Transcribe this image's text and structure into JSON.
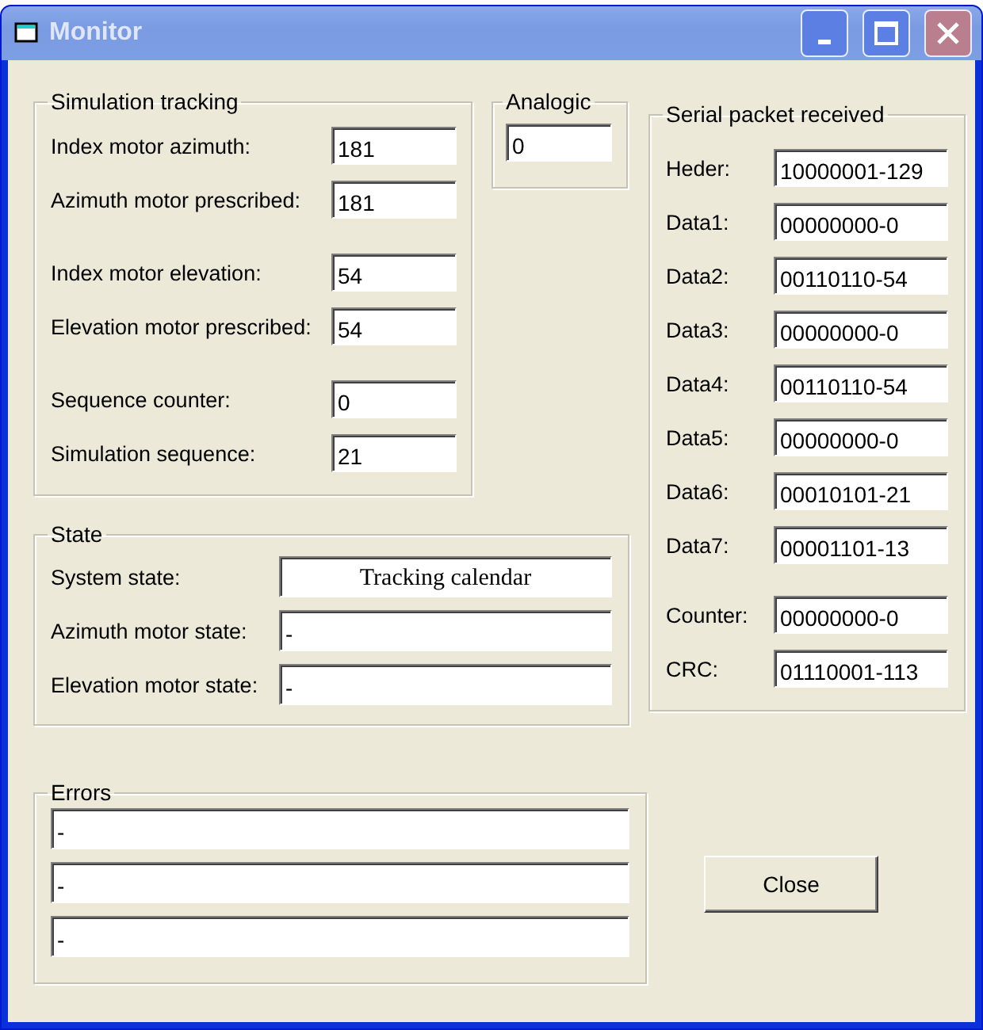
{
  "window": {
    "title": "Monitor",
    "controls": [
      {
        "kind": "minimize"
      },
      {
        "kind": "maximize"
      },
      {
        "kind": "close"
      }
    ]
  },
  "simulation_tracking": {
    "title": "Simulation tracking",
    "field_groups": [
      [
        {
          "label": "Index motor azimuth:",
          "value": "181"
        },
        {
          "label": "Azimuth motor prescribed:",
          "value": "181"
        }
      ],
      [
        {
          "label": "Index motor elevation:",
          "value": "54"
        },
        {
          "label": "Elevation motor prescribed:",
          "value": "54"
        }
      ],
      [
        {
          "label": "Sequence counter:",
          "value": "0"
        },
        {
          "label": "Simulation sequence:",
          "value": "21"
        }
      ]
    ]
  },
  "analogic": {
    "title": "Analogic",
    "value": "0"
  },
  "serial_packet": {
    "title": "Serial packet received",
    "field_groups": [
      [
        {
          "label": "Heder:",
          "value": "10000001-129"
        },
        {
          "label": "Data1:",
          "value": "00000000-0"
        },
        {
          "label": "Data2:",
          "value": "00110110-54"
        },
        {
          "label": "Data3:",
          "value": "00000000-0"
        },
        {
          "label": "Data4:",
          "value": "00110110-54"
        },
        {
          "label": "Data5:",
          "value": "00000000-0"
        },
        {
          "label": "Data6:",
          "value": "00010101-21"
        },
        {
          "label": "Data7:",
          "value": "00001101-13"
        }
      ],
      [
        {
          "label": "Counter:",
          "value": "00000000-0"
        },
        {
          "label": "CRC:",
          "value": "01110001-113"
        }
      ]
    ]
  },
  "state": {
    "title": "State",
    "fields": [
      {
        "label": "System state:",
        "value": "Tracking calendar",
        "kind": "centered"
      },
      {
        "label": "Azimuth motor state:",
        "value": "-",
        "kind": "plain"
      },
      {
        "label": "Elevation motor state:",
        "value": "-",
        "kind": "plain"
      }
    ]
  },
  "errors": {
    "title": "Errors",
    "values": [
      "-",
      "-",
      "-"
    ]
  },
  "buttons": [
    {
      "label": "Close"
    }
  ]
}
